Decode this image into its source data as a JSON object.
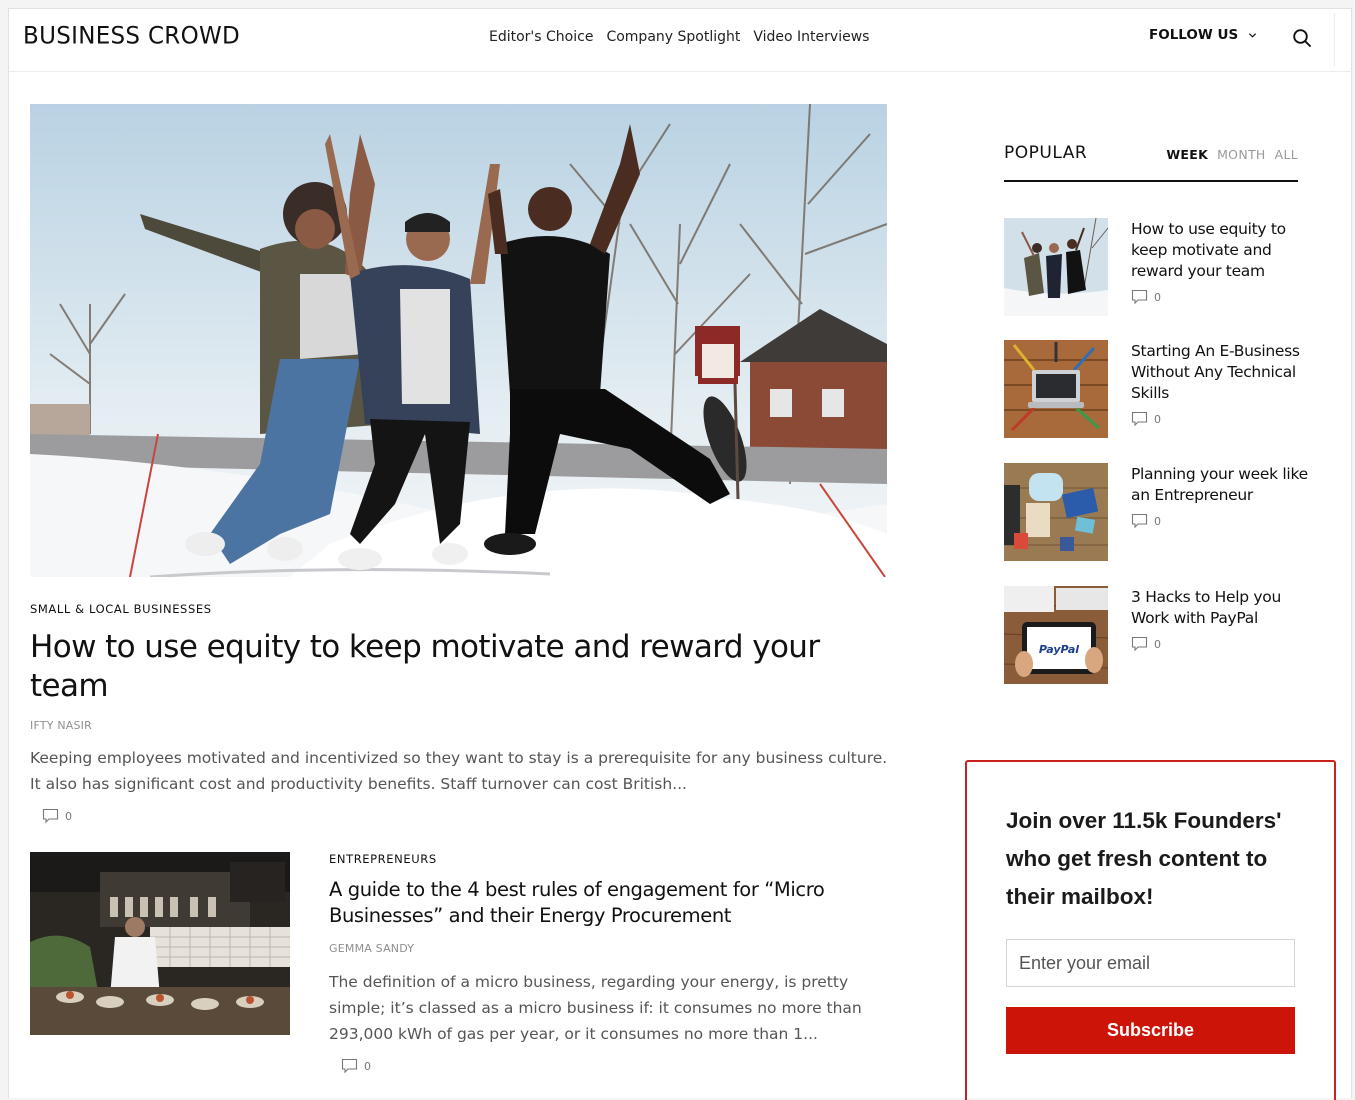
{
  "header": {
    "logo_text": "BUSINESS CROWD",
    "nav": [
      "Editor's Choice",
      "Company Spotlight",
      "Video Interviews"
    ],
    "follow_label": "FOLLOW US"
  },
  "hero": {
    "category": "SMALL & LOCAL BUSINESSES",
    "title": "How to use equity to keep motivate and reward your team",
    "author": "IFTY NASIR",
    "excerpt": "Keeping employees motivated and incentivized so they want to stay is a prerequisite for any business culture. It also has significant cost and productivity benefits. Staff turnover can cost British...",
    "comments": "0"
  },
  "article2": {
    "category": "ENTREPRENEURS",
    "title": "A guide to the 4 best rules of engagement for “Micro Businesses” and their Energy Procurement",
    "author": "GEMMA SANDY",
    "excerpt": "The definition of a micro business, regarding your energy, is pretty simple; it’s classed as a micro business if: it consumes no more than 293,000 kWh of gas per year, or it consumes no more than 1...",
    "comments": "0"
  },
  "popular": {
    "title": "POPULAR",
    "tabs": [
      "WEEK",
      "MONTH",
      "ALL"
    ],
    "active_tab": "WEEK",
    "items": [
      {
        "title": "How to use equity to keep motivate and reward your team",
        "comments": "0"
      },
      {
        "title": "Starting An E-Business Without Any Technical Skills",
        "comments": "0"
      },
      {
        "title": "Planning your week like an Entrepreneur",
        "comments": "0"
      },
      {
        "title": "3 Hacks to Help you Work with PayPal",
        "comments": "0"
      }
    ]
  },
  "newsletter": {
    "headline": "Join over 11.5k Founders' who get fresh content to their mailbox!",
    "email_placeholder": "Enter your email",
    "button_label": "Subscribe"
  },
  "images": {
    "paypal_logo_text": "PayPal"
  },
  "colors": {
    "accent_red": "#cc1508",
    "border_red": "#c9211e",
    "text_dark": "#111111",
    "text_muted": "#8e8e8e"
  }
}
